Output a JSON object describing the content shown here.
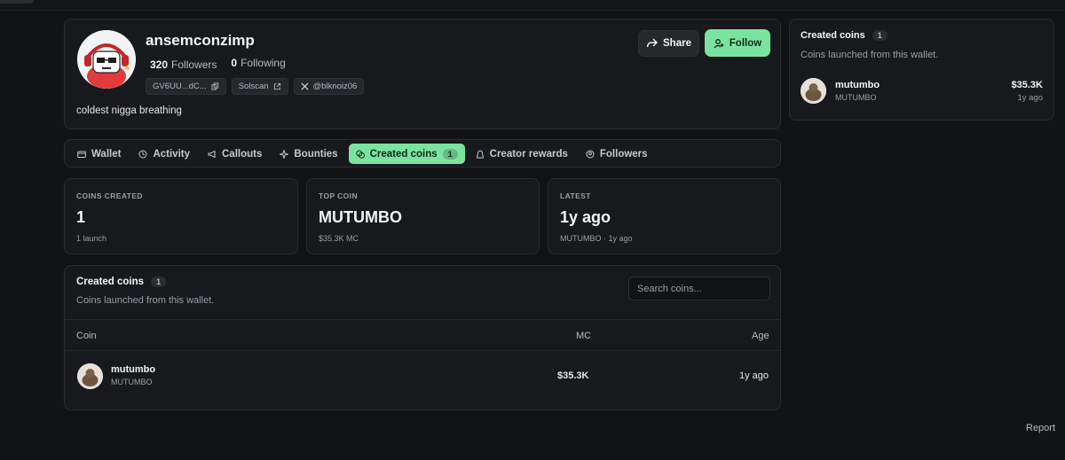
{
  "profile": {
    "username": "ansemconzimp",
    "followers_count": "320",
    "followers_label": "Followers",
    "following_count": "0",
    "following_label": "Following",
    "wallet_chip": "GV6UU...dC...",
    "solscan_chip": "Solscan",
    "twitter_chip": "@blknoiz06",
    "bio": "coldest nigga breathing",
    "share_label": "Share",
    "follow_label": "Follow"
  },
  "tabs": [
    {
      "label": "Wallet",
      "icon": "wallet-icon"
    },
    {
      "label": "Activity",
      "icon": "clock-icon"
    },
    {
      "label": "Callouts",
      "icon": "megaphone-icon"
    },
    {
      "label": "Bounties",
      "icon": "sparkle-icon"
    },
    {
      "label": "Created coins",
      "icon": "coins-icon",
      "badge": "1",
      "active": true
    },
    {
      "label": "Creator rewards",
      "icon": "bag-icon"
    },
    {
      "label": "Followers",
      "icon": "user-circle-icon"
    }
  ],
  "stats": {
    "coins_created": {
      "label": "COINS CREATED",
      "value": "1",
      "sub": "1 launch"
    },
    "top_coin": {
      "label": "TOP COIN",
      "value": "MUTUMBO",
      "sub": "$35.3K MC"
    },
    "latest": {
      "label": "LATEST",
      "value": "1y ago",
      "sub": "MUTUMBO · 1y ago"
    }
  },
  "created_coins": {
    "title": "Created coins",
    "count": "1",
    "subtitle": "Coins launched from this wallet.",
    "search_placeholder": "Search coins...",
    "columns": {
      "coin": "Coin",
      "mc": "MC",
      "age": "Age"
    },
    "rows": [
      {
        "name": "mutumbo",
        "ticker": "MUTUMBO",
        "mc": "$35.3K",
        "age": "1y ago"
      }
    ]
  },
  "side": {
    "title": "Created coins",
    "count": "1",
    "subtitle": "Coins launched from this wallet.",
    "coin_name": "mutumbo",
    "coin_ticker": "MUTUMBO",
    "coin_mc": "$35.3K",
    "coin_age": "1y ago"
  },
  "footer": {
    "report_label": "Report"
  },
  "colors": {
    "accent": "#7be3a0",
    "background": "#121315",
    "card": "#18191c"
  }
}
